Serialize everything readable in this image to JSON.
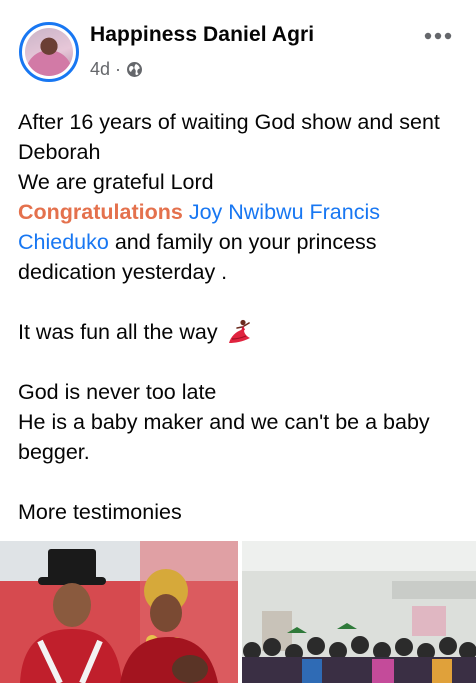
{
  "post": {
    "author": "Happiness Daniel Agri",
    "time": "4d",
    "separator": "·",
    "privacy_icon": "globe-icon",
    "more_icon": "more-options-icon",
    "body": {
      "line1": "After 16 years of waiting God show and sent Deborah",
      "line2": "We are grateful Lord",
      "congrats_word": "Congratulations",
      "mention": "Joy Nwibwu Francis Chieduko",
      "congrats_rest": " and family on your princess dedication yesterday  .",
      "fun_line": " It was fun all the way",
      "dancer_emoji": "dancer-icon",
      "line3": "God is never too late",
      "line4": "He is a baby maker and we can't be a baby begger.",
      "line5": "More testimonies"
    },
    "photos": [
      {
        "name": "photo-couple"
      },
      {
        "name": "photo-congregation"
      }
    ]
  },
  "colors": {
    "accent_congrats": "#e4714d",
    "link": "#1877f2",
    "avatar_ring": "#1877f2",
    "secondary_text": "#65676b"
  }
}
